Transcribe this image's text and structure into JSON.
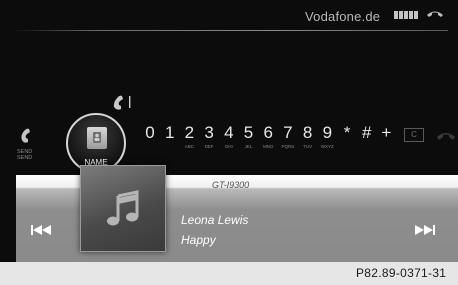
{
  "status": {
    "carrier": "Vodafone.de",
    "signal_bars": 5,
    "top_call_icon": "end-call-icon"
  },
  "dialer": {
    "send_label_line1": "SEND",
    "send_label_line2": "SEND",
    "name_label": "NAME",
    "keys": [
      {
        "digit": "0",
        "sub": ""
      },
      {
        "digit": "1",
        "sub": ""
      },
      {
        "digit": "2",
        "sub": "ABC"
      },
      {
        "digit": "3",
        "sub": "DEF"
      },
      {
        "digit": "4",
        "sub": "GHI"
      },
      {
        "digit": "5",
        "sub": "JKL"
      },
      {
        "digit": "6",
        "sub": "MNO"
      },
      {
        "digit": "7",
        "sub": "PQRS"
      },
      {
        "digit": "8",
        "sub": "TUV"
      },
      {
        "digit": "9",
        "sub": "WXYZ"
      },
      {
        "digit": "*",
        "sub": ""
      },
      {
        "digit": "#",
        "sub": ""
      },
      {
        "digit": "+",
        "sub": ""
      }
    ],
    "clear_label": "C"
  },
  "media": {
    "device": "GT-I9300",
    "artist": "Leona Lewis",
    "track": "Happy",
    "prev_icon": "skip-previous-icon",
    "next_icon": "skip-next-icon",
    "cover_icon": "music-note-icon"
  },
  "figure_code": "P82.89-0371-31",
  "colors": {
    "screen_bg": "#0c0c0c",
    "panel_light": "#f0f0f0",
    "panel_dark": "#8a8a8a"
  }
}
